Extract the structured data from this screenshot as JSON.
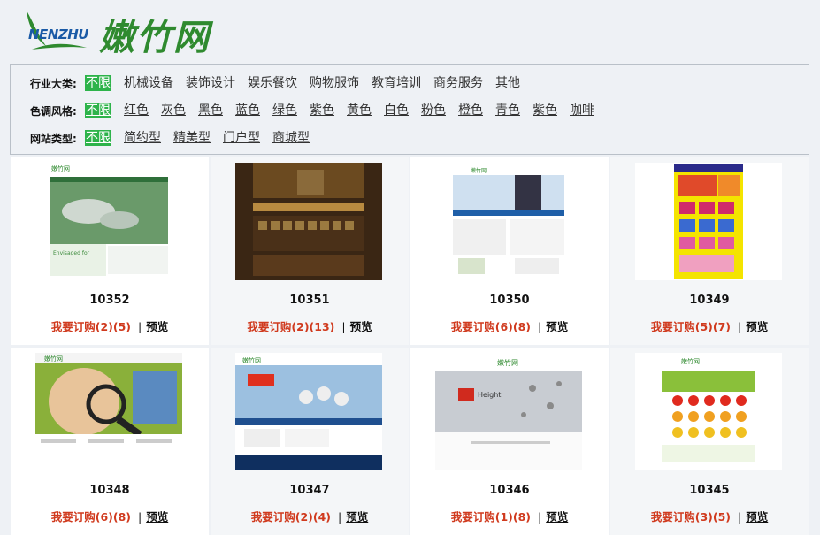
{
  "logo": {
    "en": "NENZHU",
    "cn": "嫩竹网"
  },
  "filters": [
    {
      "label": "行业大类:",
      "options": [
        "不限",
        "机械设备",
        "装饰设计",
        "娱乐餐饮",
        "购物服饰",
        "教育培训",
        "商务服务",
        "其他"
      ],
      "active": 0
    },
    {
      "label": "色调风格:",
      "options": [
        "不限",
        "红色",
        "灰色",
        "黑色",
        "蓝色",
        "绿色",
        "紫色",
        "黄色",
        "白色",
        "粉色",
        "橙色",
        "青色",
        "紫色",
        "咖啡"
      ],
      "active": 0
    },
    {
      "label": "网站类型:",
      "options": [
        "不限",
        "简约型",
        "精美型",
        "门户型",
        "商城型"
      ],
      "active": 0
    }
  ],
  "cards": [
    {
      "id": "10352",
      "order": "我要订购(2)(5)",
      "preview": "预览"
    },
    {
      "id": "10351",
      "order": "我要订购(2)(13)",
      "preview": "预览"
    },
    {
      "id": "10350",
      "order": "我要订购(6)(8)",
      "preview": "预览"
    },
    {
      "id": "10349",
      "order": "我要订购(5)(7)",
      "preview": "预览"
    },
    {
      "id": "10348",
      "order": "我要订购(6)(8)",
      "preview": "预览"
    },
    {
      "id": "10347",
      "order": "我要订购(2)(4)",
      "preview": "预览"
    },
    {
      "id": "10346",
      "order": "我要订购(1)(8)",
      "preview": "预览"
    },
    {
      "id": "10345",
      "order": "我要订购(3)(5)",
      "preview": "预览"
    }
  ],
  "colors": {
    "accent": "#2db34a",
    "order": "#d03a1e",
    "logo_green": "#2f8a2f",
    "logo_blue": "#1a5aa6"
  }
}
